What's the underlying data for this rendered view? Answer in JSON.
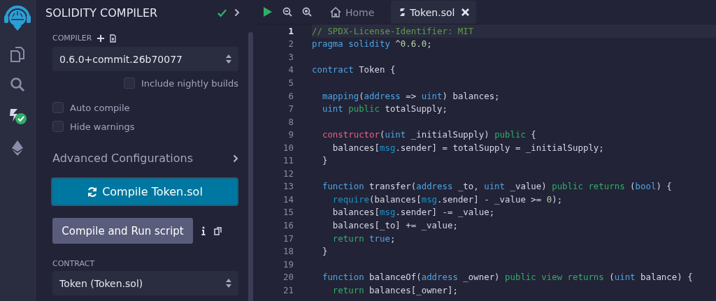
{
  "sidebar": {
    "title": "SOLIDITY COMPILER",
    "compiler_label": "COMPILER",
    "compiler_version": "0.6.0+commit.26b70077",
    "nightly": {
      "label": "Include nightly builds",
      "checked": false
    },
    "options": [
      {
        "label": "Auto compile",
        "checked": false
      },
      {
        "label": "Hide warnings",
        "checked": false
      }
    ],
    "advanced": "Advanced Configurations",
    "compile_button": "Compile Token.sol",
    "run_button": "Compile and Run script",
    "contract_label": "CONTRACT",
    "contract": "Token (Token.sol)"
  },
  "tabs": [
    {
      "label": "Home",
      "kind": "home",
      "selected": false
    },
    {
      "label": "Token.sol",
      "kind": "file",
      "selected": true
    }
  ],
  "editor": {
    "lines": [
      {
        "number": "1",
        "current": true,
        "tokens": [
          {
            "text": "// SPDX-License-Identifier: MIT",
            "kind": "comment"
          }
        ]
      },
      {
        "number": "2",
        "current": false,
        "tokens": [
          {
            "text": "pragma",
            "kind": "keyword"
          },
          {
            "text": " solidity",
            "kind": "keyword"
          },
          {
            "text": " ^",
            "kind": "plain"
          },
          {
            "text": "0.6.0",
            "kind": "number"
          },
          {
            "text": ";",
            "kind": "plain"
          }
        ]
      },
      {
        "number": "3",
        "current": false
      },
      {
        "number": "4",
        "current": false,
        "tokens": [
          {
            "text": "contract",
            "kind": "keyword"
          },
          {
            "text": " Token {",
            "kind": "plain"
          }
        ]
      },
      {
        "number": "5",
        "current": false
      },
      {
        "number": "6",
        "current": false,
        "tokens": [
          {
            "text": "  mapping",
            "kind": "keyword"
          },
          {
            "text": "(",
            "kind": "plain"
          },
          {
            "text": "address",
            "kind": "keyword"
          },
          {
            "text": " => ",
            "kind": "plain"
          },
          {
            "text": "uint",
            "kind": "keyword"
          },
          {
            "text": ") balances;",
            "kind": "plain"
          }
        ]
      },
      {
        "number": "7",
        "current": false,
        "tokens": [
          {
            "text": "  uint",
            "kind": "keyword"
          },
          {
            "text": " public",
            "kind": "modifier"
          },
          {
            "text": " totalSupply;",
            "kind": "plain"
          }
        ]
      },
      {
        "number": "8",
        "current": false
      },
      {
        "number": "9",
        "current": false,
        "tokens": [
          {
            "text": "  constructor",
            "kind": "special"
          },
          {
            "text": "(",
            "kind": "plain"
          },
          {
            "text": "uint",
            "kind": "keyword"
          },
          {
            "text": " _initialSupply) ",
            "kind": "plain"
          },
          {
            "text": "public",
            "kind": "modifier"
          },
          {
            "text": " {",
            "kind": "plain"
          }
        ]
      },
      {
        "number": "10",
        "current": false,
        "tokens": [
          {
            "text": "    balances[",
            "kind": "plain"
          },
          {
            "text": "msg",
            "kind": "builtin"
          },
          {
            "text": ".sender] = totalSupply = _initialSupply;",
            "kind": "plain"
          }
        ]
      },
      {
        "number": "11",
        "current": false,
        "tokens": [
          {
            "text": "  }",
            "kind": "plain"
          }
        ]
      },
      {
        "number": "12",
        "current": false
      },
      {
        "number": "13",
        "current": false,
        "tokens": [
          {
            "text": "  function",
            "kind": "keyword"
          },
          {
            "text": " transfer(",
            "kind": "plain"
          },
          {
            "text": "address",
            "kind": "keyword"
          },
          {
            "text": " _to, ",
            "kind": "plain"
          },
          {
            "text": "uint",
            "kind": "keyword"
          },
          {
            "text": " _value) ",
            "kind": "plain"
          },
          {
            "text": "public",
            "kind": "modifier"
          },
          {
            "text": " returns",
            "kind": "modifier"
          },
          {
            "text": " (",
            "kind": "plain"
          },
          {
            "text": "bool",
            "kind": "keyword"
          },
          {
            "text": ") {",
            "kind": "plain"
          }
        ]
      },
      {
        "number": "14",
        "current": false,
        "tokens": [
          {
            "text": "    require",
            "kind": "builtin"
          },
          {
            "text": "(balances[",
            "kind": "plain"
          },
          {
            "text": "msg",
            "kind": "builtin"
          },
          {
            "text": ".sender] - _value >= ",
            "kind": "plain"
          },
          {
            "text": "0",
            "kind": "number"
          },
          {
            "text": ");",
            "kind": "plain"
          }
        ]
      },
      {
        "number": "15",
        "current": false,
        "tokens": [
          {
            "text": "    balances[",
            "kind": "plain"
          },
          {
            "text": "msg",
            "kind": "builtin"
          },
          {
            "text": ".sender] -= _value;",
            "kind": "plain"
          }
        ]
      },
      {
        "number": "16",
        "current": false,
        "tokens": [
          {
            "text": "    balances[_to] += _value;",
            "kind": "plain"
          }
        ]
      },
      {
        "number": "17",
        "current": false,
        "tokens": [
          {
            "text": "    return",
            "kind": "modifier"
          },
          {
            "text": " true",
            "kind": "keyword"
          },
          {
            "text": ";",
            "kind": "plain"
          }
        ]
      },
      {
        "number": "18",
        "current": false,
        "tokens": [
          {
            "text": "  }",
            "kind": "plain"
          }
        ]
      },
      {
        "number": "19",
        "current": false
      },
      {
        "number": "20",
        "current": false,
        "tokens": [
          {
            "text": "  function",
            "kind": "keyword"
          },
          {
            "text": " balanceOf(",
            "kind": "plain"
          },
          {
            "text": "address",
            "kind": "keyword"
          },
          {
            "text": " _owner) ",
            "kind": "plain"
          },
          {
            "text": "public",
            "kind": "modifier"
          },
          {
            "text": " view",
            "kind": "modifier"
          },
          {
            "text": " returns",
            "kind": "modifier"
          },
          {
            "text": " (",
            "kind": "plain"
          },
          {
            "text": "uint",
            "kind": "keyword"
          },
          {
            "text": " balance) {",
            "kind": "plain"
          }
        ]
      },
      {
        "number": "21",
        "current": false,
        "tokens": [
          {
            "text": "    return",
            "kind": "modifier"
          },
          {
            "text": " balances[_owner];",
            "kind": "plain"
          }
        ]
      }
    ]
  }
}
